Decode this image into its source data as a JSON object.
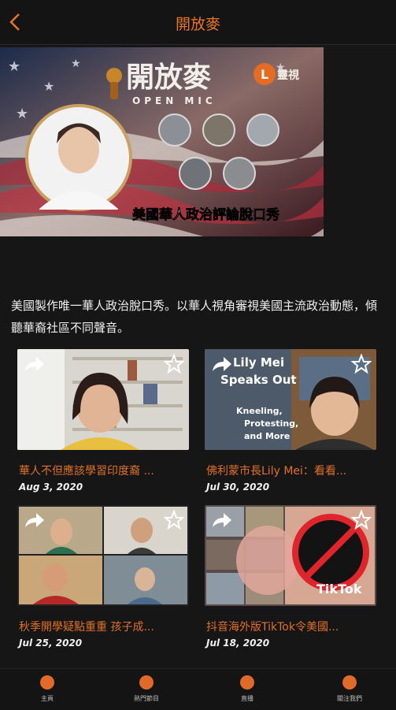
{
  "header": {
    "title": "開放麥"
  },
  "banner": {
    "logo_text": "開放麥",
    "logo_sub": "OPEN MIC",
    "channel_badge": "L",
    "channel_name": "靈視",
    "tagline": "美國華人政治評論脫口秀"
  },
  "description": "美國製作唯一華人政治脫口秀。以華人視角審視美國主流政治動態，傾聽華裔社區不同聲音。",
  "cards": [
    {
      "title": "華人不但應該學習印度裔 ...",
      "date": "Aug 3, 2020"
    },
    {
      "title": "佛利蒙市長Lily Mei：看看...",
      "date": "Jul 30, 2020",
      "thumb_text": [
        "Lily Mei",
        "Speaks Out",
        "Kneeling,",
        "Protesting,",
        "and More"
      ]
    },
    {
      "title": "秋季開學疑點重重 孩子成...",
      "date": "Jul 25, 2020"
    },
    {
      "title": "抖音海外版TikTok令美國...",
      "date": "Jul 18, 2020",
      "thumb_text": [
        "TikTok"
      ]
    }
  ],
  "bottom_nav": [
    {
      "label": "主頁",
      "icon": "home-icon"
    },
    {
      "label": "熱門節目",
      "icon": "tv-icon"
    },
    {
      "label": "直播",
      "icon": "play-icon"
    },
    {
      "label": "關注我們",
      "icon": "heart-icon"
    }
  ]
}
